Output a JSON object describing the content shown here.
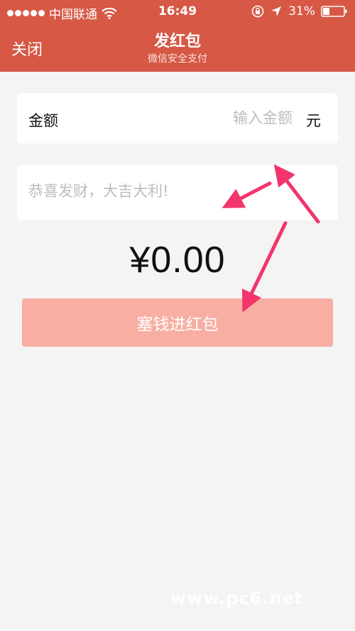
{
  "status_bar": {
    "carrier": "中国联通",
    "time": "16:49",
    "battery": "31%"
  },
  "nav": {
    "close_label": "关闭",
    "title": "发红包",
    "subtitle": "微信安全支付"
  },
  "amount_field": {
    "label": "金额",
    "placeholder": "输入金额",
    "value": "",
    "unit": "元"
  },
  "message_field": {
    "placeholder": "恭喜发财，大吉大利!",
    "value": ""
  },
  "amount_display": "¥0.00",
  "submit_button": {
    "label": "塞钱进红包"
  },
  "watermark": "www.pc6.net",
  "colors": {
    "header": "#d65845",
    "button": "#f8aea3",
    "background": "#f4f4f4",
    "arrow": "#f2356b"
  }
}
